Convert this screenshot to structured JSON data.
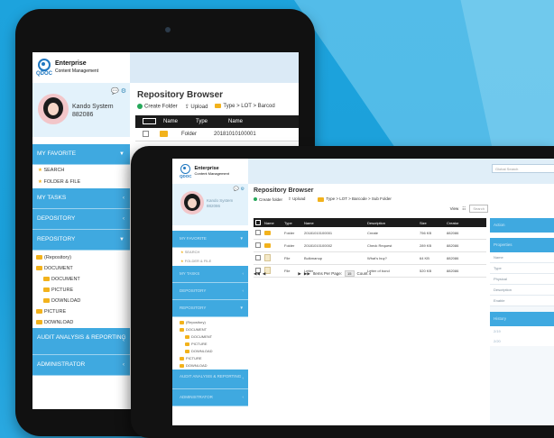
{
  "brand": {
    "q": "Q",
    "name_line1": "Enterprise",
    "name_line2": "Content Management",
    "doc": "DOC"
  },
  "back_device": {
    "user": {
      "name": "Kando System",
      "id": "882086"
    },
    "menu": {
      "my_favorite": "MY FAVORITE",
      "search": "SEARCH",
      "folder_file": "FOLDER & FILE",
      "my_tasks": "MY TASKS",
      "depository": "DEPOSITORY",
      "repository": "REPOSITORY",
      "tree": [
        "(Repository)",
        "DOCUMENT",
        "DOCUMENT",
        "PICTURE",
        "DOWNLOAD",
        "PICTURE",
        "DOWNLOAD"
      ],
      "audit": "AUDIT ANALYSIS & REPORTING",
      "administrator": "ADMINISTRATOR"
    },
    "main": {
      "title_a": "Repos",
      "title_b": "itory Browser",
      "create_folder": "Create Folder",
      "upload": "Upload",
      "breadcrumb": "Type > LOT > Barcod",
      "columns": [
        "Name",
        "Type",
        "Name"
      ],
      "row": {
        "type": "Folder",
        "name": "20181010100001"
      }
    }
  },
  "front_device": {
    "search_placeholder": "Global Search",
    "user": {
      "name": "Kando System",
      "id": "882086"
    },
    "menu": {
      "my_favorite": "MY FAVORITE",
      "search": "SEARCH",
      "folder_file": "FOLDER & FILE",
      "my_tasks": "MY TASKS",
      "depository": "DEPOSITORY",
      "repository": "REPOSITORY",
      "tree": [
        "(Repository)",
        "DOCUMENT",
        "DOCUMENT",
        "PICTURE",
        "DOWNLOAD",
        "PICTURE",
        "DOWNLOAD"
      ],
      "audit": "AUDIT ANALYSIS & REPORTING",
      "administrator": "ADMINISTRATOR"
    },
    "main": {
      "title": "Repository Browser",
      "create_folder": "Create folder",
      "upload": "Upload",
      "breadcrumb": "Type > LOT > Barcode > Sub Folder",
      "view_label": "View",
      "view_search": "Search",
      "columns": [
        "Name",
        "Type",
        "Name",
        "Description",
        "Size",
        "Creator"
      ],
      "rows": [
        {
          "type": "Folder",
          "name": "20181010100001",
          "description": "Create",
          "size": "756 KB",
          "creator": "882086"
        },
        {
          "type": "Folder",
          "name": "20181010100002",
          "description": "Check Request",
          "size": "289 KB",
          "creator": "882086"
        },
        {
          "type": "File",
          "name": "Bulkmanup",
          "description": "What's buy?",
          "size": "64 KB",
          "creator": "882086"
        },
        {
          "type": "File",
          "name": "Letter",
          "description": "Letter of bond",
          "size": "520 KB",
          "creator": "882086"
        }
      ],
      "pager": {
        "first": "◀◀",
        "prev": "◀",
        "next": "▶",
        "last": "▶▶",
        "items_label": "Items Per Page:",
        "per_page": "15",
        "count": "Count 4"
      }
    },
    "right_panel": {
      "action": "Action",
      "properties": "Properties",
      "fields": [
        "Name",
        "Type",
        "Physical",
        "Description",
        "Enable"
      ],
      "history": "History",
      "history_items": [
        "2/19",
        "2/20"
      ]
    }
  }
}
